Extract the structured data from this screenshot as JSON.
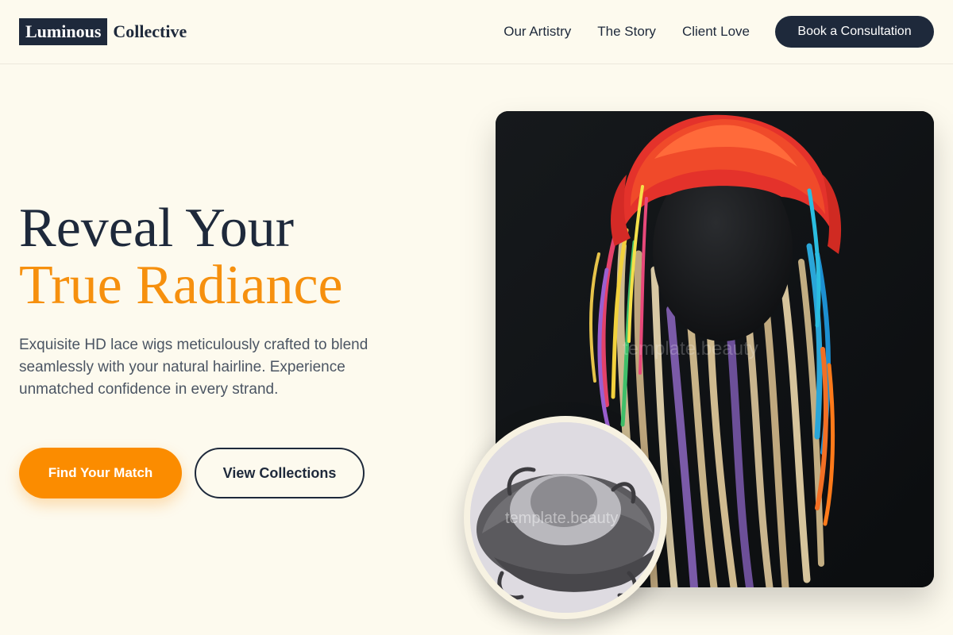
{
  "header": {
    "logo_highlight": "Luminous",
    "logo_word": "Collective",
    "nav": [
      {
        "label": "Our Artistry"
      },
      {
        "label": "The Story"
      },
      {
        "label": "Client Love"
      }
    ],
    "cta_label": "Book a Consultation"
  },
  "hero": {
    "title_line1": "Reveal Your",
    "title_line2": "True Radiance",
    "subtitle": "Exquisite HD lace wigs meticulously crafted to blend seamlessly with your natural hairline. Experience unmatched confidence in every strand.",
    "primary_button": "Find Your Match",
    "secondary_button": "View Collections"
  },
  "images": {
    "main_watermark": "template.beauty",
    "circle_watermark": "template.beauty"
  },
  "colors": {
    "background": "#fdfaee",
    "navy": "#1e293b",
    "accent_orange": "#fb8c00"
  }
}
